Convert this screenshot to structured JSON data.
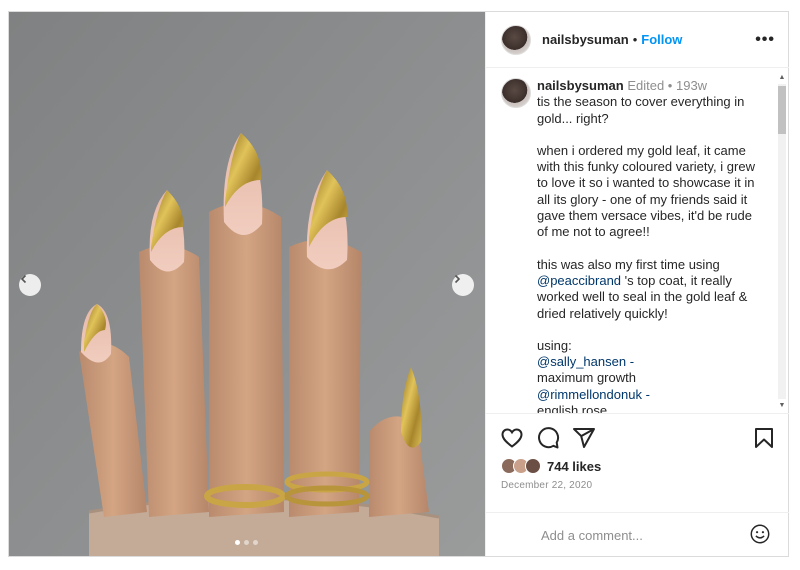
{
  "post": {
    "username": "nailsbysuman",
    "follow_label": "Follow",
    "separator": "•",
    "more_label": "•••",
    "edited_label": "Edited •",
    "age": "193w",
    "caption": {
      "line1": "tis the season to cover everything in gold... right?",
      "para2": "when i ordered my gold leaf, it came with this funky coloured variety, i grew to love it so i wanted to showcase it in all its glory - one of my friends said it gave them versace vibes, it'd be rude of me not to agree!!",
      "para3a": "this was also my first time using",
      "mention1": "@peaccibrand",
      "para3b": "'s top coat, it really worked well to seal in the gold leaf & dried relatively quickly!",
      "using": "using:",
      "mention2": "@sally_hansen -",
      "product2": "maximum growth",
      "mention3": "@rimmellondonuk -",
      "product3": "english rose"
    },
    "likes": "744 likes",
    "date": "December 22, 2020",
    "comment_placeholder": "Add a comment...",
    "carousel": {
      "slides": 3,
      "active": 0
    }
  },
  "icons": {
    "like": "heart-icon",
    "comment": "comment-icon",
    "share": "share-icon",
    "save": "bookmark-icon",
    "emoji": "emoji-icon",
    "prev": "chevron-left-icon",
    "next": "chevron-right-icon"
  },
  "colors": {
    "link": "#0095f6",
    "mention": "#00376b",
    "muted": "#8e8e8e",
    "text": "#262626"
  }
}
